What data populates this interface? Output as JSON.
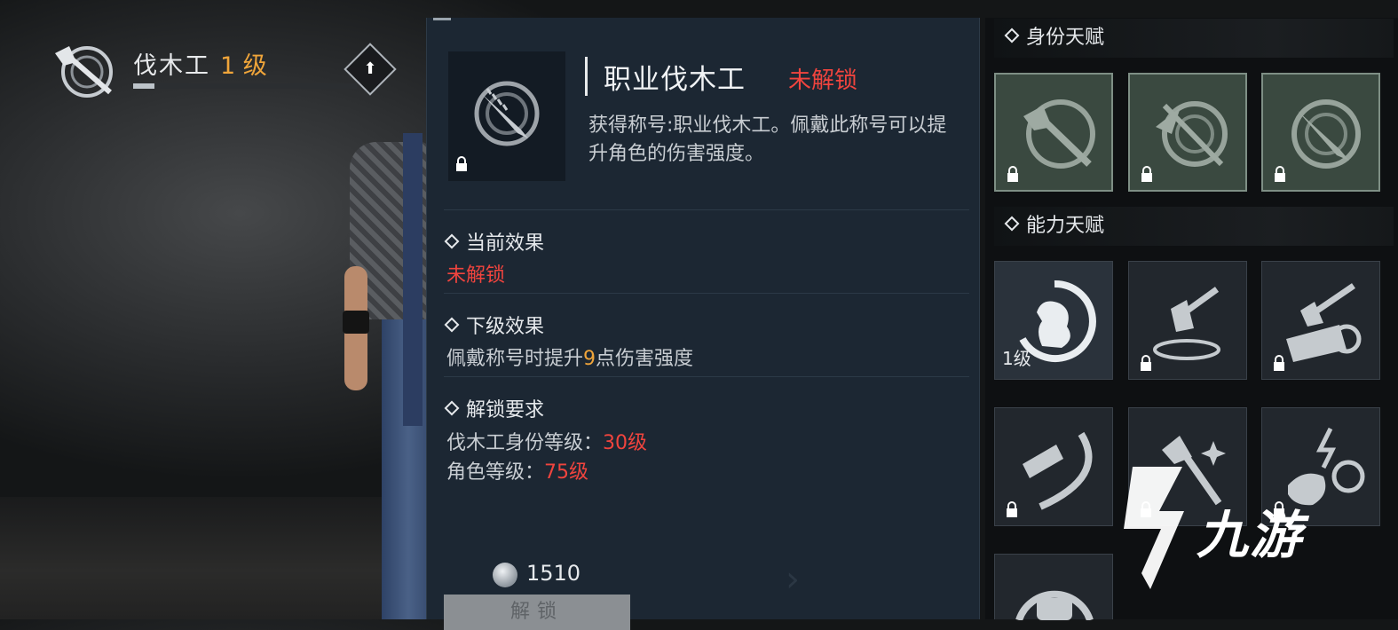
{
  "header": {
    "class_name": "伐木工",
    "class_level": "1 级",
    "emblem_icon": "axe-stump-icon",
    "upgrade_icon": "upload-arrow-icon"
  },
  "detail": {
    "title": "职业伐木工",
    "status": "未解锁",
    "icon": "saw-stump-icon",
    "description": "获得称号:职业伐木工。佩戴此称号可以提升角色的伤害强度。",
    "current_effect": {
      "heading": "当前效果",
      "value": "未解锁"
    },
    "next_effect": {
      "heading": "下级效果",
      "prefix": "佩戴称号时提升",
      "number": "9",
      "suffix": "点伤害强度"
    },
    "requirements": {
      "heading": "解锁要求",
      "items": [
        {
          "label": "伐木工身份等级：",
          "value": "30级"
        },
        {
          "label": "角色等级：",
          "value": "75级"
        }
      ]
    },
    "cost": {
      "icon": "silver-coin-icon",
      "value": "1510"
    },
    "unlock_button": "解锁"
  },
  "identity_talents": {
    "heading": "身份天赋",
    "tiles": [
      {
        "icon": "axe-stump-icon",
        "locked": true
      },
      {
        "icon": "crossed-axe-stump-icon",
        "locked": true
      },
      {
        "icon": "saw-stump-icon",
        "locked": true
      }
    ]
  },
  "ability_talents": {
    "heading": "能力天赋",
    "tiles": [
      {
        "icon": "strength-arm-icon",
        "locked": false,
        "level": "1级"
      },
      {
        "icon": "axe-in-ground-icon",
        "locked": true
      },
      {
        "icon": "axe-log-icon",
        "locked": true
      },
      {
        "icon": "chainsaw-slash-icon",
        "locked": true
      },
      {
        "icon": "sparkling-axe-icon",
        "locked": true
      },
      {
        "icon": "energy-flask-icon",
        "locked": true
      },
      {
        "icon": "fist-icon",
        "locked": true
      }
    ]
  },
  "watermark": {
    "text": "九游",
    "icon": "jiuyou-logo-icon"
  },
  "colors": {
    "accent_gold": "#f0a53a",
    "locked_red": "#f0443e",
    "panel_bg": "#1c2733",
    "identity_tile": "#3a4940"
  }
}
